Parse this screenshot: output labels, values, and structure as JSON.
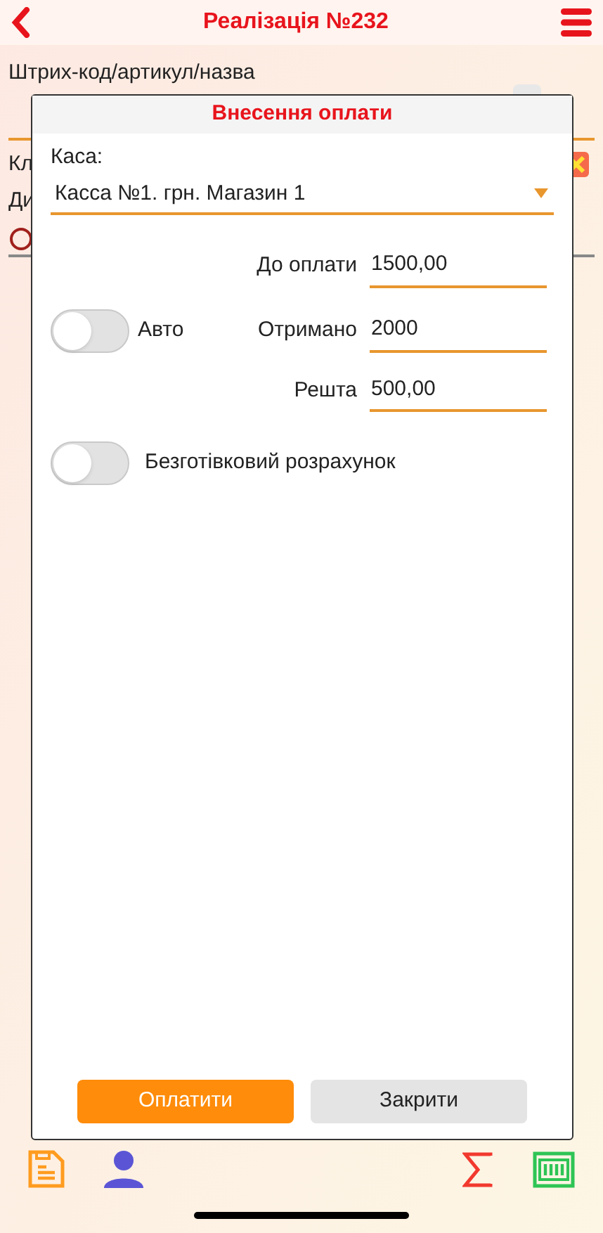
{
  "header": {
    "title": "Реалізація №232"
  },
  "page": {
    "barcode_label": "Штрих-код/артикул/назва",
    "client_label": "Кл",
    "discount_label": "Ди"
  },
  "dialog": {
    "title": "Внесення оплати",
    "cash_label": "Каса:",
    "cash_value": "Касса №1. грн. Магазин 1",
    "amounts": [
      {
        "label": "До оплати",
        "value": "1500,00"
      },
      {
        "label": "Отримано",
        "value": "2000"
      },
      {
        "label": "Решта",
        "value": "500,00"
      }
    ],
    "auto": {
      "label": "Авто",
      "on": false
    },
    "cashless": {
      "label": "Безготівковий розрахунок",
      "on": false
    },
    "buttons": [
      {
        "label": "Оплатити",
        "kind": "primary"
      },
      {
        "label": "Закрити",
        "kind": "secondary"
      }
    ]
  }
}
